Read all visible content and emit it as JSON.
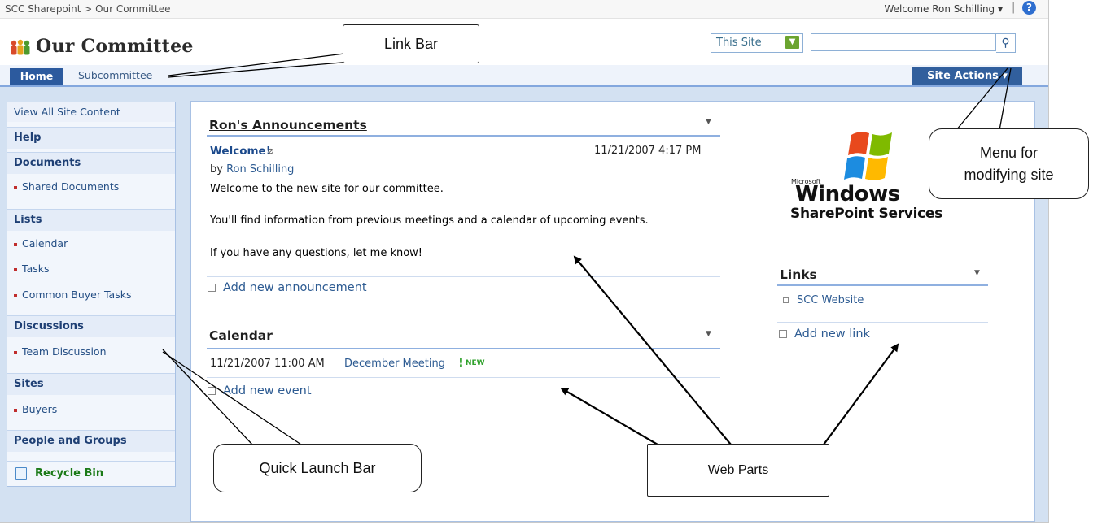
{
  "topbar": {
    "breadcrumb": "SCC Sharepoint > Our Committee",
    "welcome": "Welcome Ron Schilling ▾",
    "separator": "|",
    "help_icon": "help-icon"
  },
  "header": {
    "site_title": "Our Committee",
    "scope_select": "This Site",
    "search_placeholder": "",
    "search_button_icon": "search-icon"
  },
  "tabs": {
    "home": "Home",
    "subcommittee": "Subcommittee",
    "site_actions": "Site Actions ▾"
  },
  "quick_launch": {
    "view_all": "View All Site Content",
    "help": "Help",
    "documents": "Documents",
    "shared_documents": "Shared Documents",
    "lists": "Lists",
    "calendar": "Calendar",
    "tasks": "Tasks",
    "common_buyer_tasks": "Common Buyer Tasks",
    "discussions": "Discussions",
    "team_discussion": "Team Discussion",
    "sites": "Sites",
    "buyers": "Buyers",
    "people_groups": "People and Groups",
    "recycle_bin": "Recycle Bin"
  },
  "announcements": {
    "title": "Ron's Announcements",
    "item_title": "Welcome!",
    "item_date": "11/21/2007 4:17 PM",
    "by_prefix": "by ",
    "by_author": "Ron Schilling",
    "body_1": "Welcome to the new site for our committee.",
    "body_2": "You'll find information from previous meetings and a calendar of upcoming events.",
    "body_3": "If you have any questions, let me know!",
    "add_link": "Add new announcement"
  },
  "calendar": {
    "title": "Calendar",
    "event_date": "11/21/2007 11:00 AM",
    "event_title": "December Meeting",
    "new_badge": "NEW",
    "add_link": "Add new event"
  },
  "logo": {
    "microsoft": "Microsoft",
    "windows": "Windows",
    "sharepoint": "SharePoint Services"
  },
  "links": {
    "title": "Links",
    "item": "SCC Website",
    "add_link": "Add new link"
  },
  "callouts": {
    "link_bar": "Link Bar",
    "menu_line1": "Menu for",
    "menu_line2": "modifying site",
    "quick_launch": "Quick Launch Bar",
    "web_parts": "Web Parts"
  },
  "colors": {
    "accent_dark_blue": "#2c5a9e",
    "link_blue": "#2d5b92",
    "new_green": "#2fa12b",
    "quicklaunch_bg": "#f2f6fc"
  }
}
